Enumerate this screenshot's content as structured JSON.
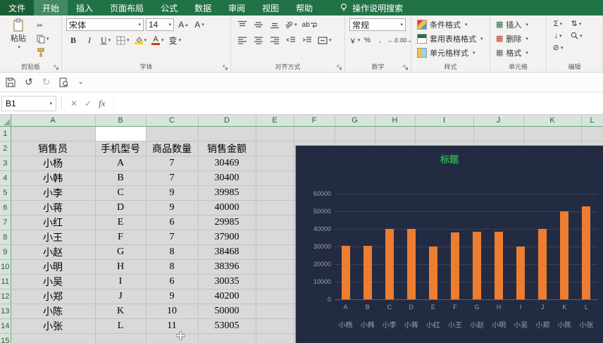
{
  "menu": {
    "tabs": [
      {
        "label": "文件",
        "style": "file"
      },
      {
        "label": "开始",
        "style": "active"
      },
      {
        "label": "插入",
        "style": ""
      },
      {
        "label": "页面布局",
        "style": ""
      },
      {
        "label": "公式",
        "style": ""
      },
      {
        "label": "数据",
        "style": ""
      },
      {
        "label": "审阅",
        "style": ""
      },
      {
        "label": "视图",
        "style": ""
      },
      {
        "label": "帮助",
        "style": ""
      }
    ],
    "search_label": "操作说明搜索"
  },
  "ribbon": {
    "clipboard": {
      "label": "剪贴板",
      "paste": "粘贴"
    },
    "font": {
      "label": "字体",
      "font_name": "宋体",
      "font_size": "14"
    },
    "alignment": {
      "label": "对齐方式"
    },
    "number": {
      "label": "数字",
      "format": "常规"
    },
    "styles": {
      "label": "样式",
      "items": [
        "条件格式",
        "套用表格格式",
        "单元格样式"
      ]
    },
    "cells": {
      "label": "单元格",
      "items": [
        "插入",
        "删除",
        "格式"
      ]
    },
    "editing": {
      "label": "编辑"
    }
  },
  "formula_bar": {
    "name_box": "B1",
    "formula": ""
  },
  "icons": {
    "dropdown": "▾",
    "up": "▴",
    "down": "▾",
    "bold": "B",
    "italic": "I",
    "underline": "U",
    "scissors": "✂",
    "phonetic": "变",
    "wrap_text": "ab",
    "currency": "￥",
    "percent": "%",
    "comma": ",",
    "increase_decimal": "←.0",
    "decrease_decimal": ".00→",
    "cancel": "✕",
    "enter": "✓",
    "fx": "fx",
    "undo": "↺",
    "redo": "↻",
    "more": "⌄",
    "sigma": "Σ",
    "sort": "⇅",
    "fill_down": "↓",
    "clear": "⊘",
    "orientation": "ab",
    "font_letter": "A",
    "grid_square": "▦"
  },
  "sheet": {
    "columns": [
      "A",
      "B",
      "C",
      "D",
      "E",
      "F",
      "G",
      "H",
      "I",
      "J",
      "K",
      "L"
    ],
    "row_count": 15,
    "active_cell": "B1",
    "table": {
      "start_row": 2,
      "headers": [
        "销售员",
        "手机型号",
        "商品数量",
        "销售金额"
      ],
      "rows": [
        [
          "小杨",
          "A",
          "7",
          "30469"
        ],
        [
          "小韩",
          "B",
          "7",
          "30400"
        ],
        [
          "小李",
          "C",
          "9",
          "39985"
        ],
        [
          "小蒋",
          "D",
          "9",
          "40000"
        ],
        [
          "小红",
          "E",
          "6",
          "29985"
        ],
        [
          "小王",
          "F",
          "7",
          "37900"
        ],
        [
          "小赵",
          "G",
          "8",
          "38468"
        ],
        [
          "小明",
          "H",
          "8",
          "38396"
        ],
        [
          "小吴",
          "I",
          "6",
          "30035"
        ],
        [
          "小郑",
          "J",
          "9",
          "40200"
        ],
        [
          "小陈",
          "K",
          "10",
          "50000"
        ],
        [
          "小张",
          "L",
          "11",
          "53005"
        ]
      ]
    }
  },
  "chart_data": {
    "type": "bar",
    "title": "标题",
    "categories": [
      "A",
      "B",
      "C",
      "D",
      "E",
      "F",
      "G",
      "H",
      "I",
      "J",
      "K",
      "L"
    ],
    "category_names": [
      "小杨",
      "小韩",
      "小李",
      "小蒋",
      "小红",
      "小王",
      "小赵",
      "小明",
      "小吴",
      "小郑",
      "小陈",
      "小张"
    ],
    "series": [
      {
        "name": "销售金额",
        "values": [
          30469,
          30400,
          39985,
          40000,
          29985,
          37900,
          38468,
          38396,
          30035,
          40200,
          50000,
          53005
        ]
      }
    ],
    "ylim": [
      0,
      60000
    ],
    "ytick_step": 10000,
    "grid": true,
    "legend": false,
    "colors": {
      "background": "#232B43",
      "bar": "#ED7D31",
      "title": "#2DA44E",
      "axis_text": "#98A0AE",
      "gridline": "#3A4258"
    }
  }
}
